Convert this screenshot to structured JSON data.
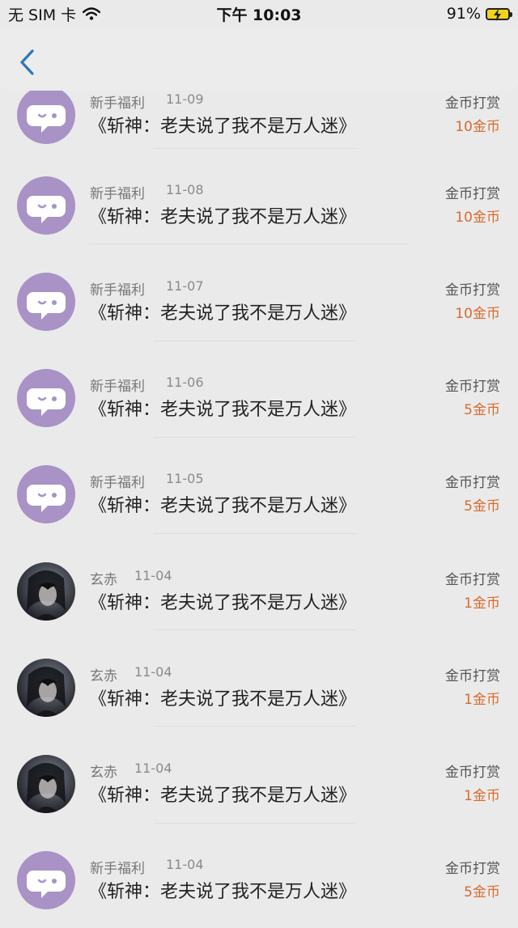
{
  "status_bar": {
    "carrier": "无 SIM 卡",
    "time": "下午 10:03",
    "battery": "91%"
  },
  "rows": [
    {
      "avatar": "purple",
      "name": "新手福利",
      "date": "11-09",
      "book": "《斩神：老夫说了我不是万人迷》",
      "type": "金币打赏",
      "amount": "10金币"
    },
    {
      "avatar": "purple",
      "name": "新手福利",
      "date": "11-08",
      "book": "《斩神：老夫说了我不是万人迷》",
      "type": "金币打赏",
      "amount": "10金币"
    },
    {
      "avatar": "purple",
      "name": "新手福利",
      "date": "11-07",
      "book": "《斩神：老夫说了我不是万人迷》",
      "type": "金币打赏",
      "amount": "10金币"
    },
    {
      "avatar": "purple",
      "name": "新手福利",
      "date": "11-06",
      "book": "《斩神：老夫说了我不是万人迷》",
      "type": "金币打赏",
      "amount": "5金币"
    },
    {
      "avatar": "purple",
      "name": "新手福利",
      "date": "11-05",
      "book": "《斩神：老夫说了我不是万人迷》",
      "type": "金币打赏",
      "amount": "5金币"
    },
    {
      "avatar": "dark",
      "name": "玄赤",
      "date": "11-04",
      "book": "《斩神：老夫说了我不是万人迷》",
      "type": "金币打赏",
      "amount": "1金币"
    },
    {
      "avatar": "dark",
      "name": "玄赤",
      "date": "11-04",
      "book": "《斩神：老夫说了我不是万人迷》",
      "type": "金币打赏",
      "amount": "1金币"
    },
    {
      "avatar": "dark",
      "name": "玄赤",
      "date": "11-04",
      "book": "《斩神：老夫说了我不是万人迷》",
      "type": "金币打赏",
      "amount": "1金币"
    },
    {
      "avatar": "purple",
      "name": "新手福利",
      "date": "11-04",
      "book": "《斩神：老夫说了我不是万人迷》",
      "type": "金币打赏",
      "amount": "5金币"
    }
  ]
}
